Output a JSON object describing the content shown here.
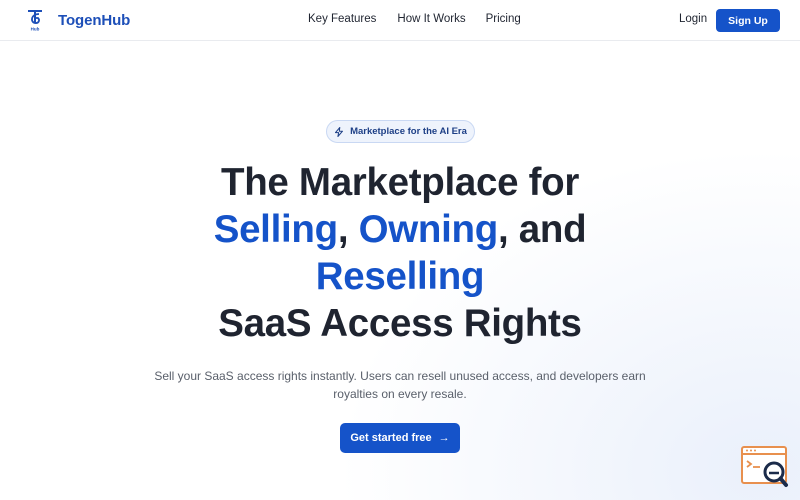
{
  "brand": {
    "name": "TogenHub",
    "logo_text": "Hub"
  },
  "nav": {
    "links": [
      "Key Features",
      "How It Works",
      "Pricing"
    ],
    "login": "Login",
    "signup": "Sign Up"
  },
  "hero": {
    "badge": "Marketplace for the AI Era",
    "headline": {
      "line1": "The Marketplace for",
      "word1": "Selling",
      "sep1": ", ",
      "word2": "Owning",
      "sep2": ", and",
      "word3": "Reselling",
      "line4": "SaaS Access Rights"
    },
    "subtitle": "Sell your SaaS access rights instantly. Users can resell unused access, and developers earn royalties on every resale.",
    "cta": "Get started free"
  },
  "colors": {
    "brand_blue": "#1553c9",
    "text_dark": "#1f2430",
    "widget_orange": "#e8904e",
    "widget_navy": "#1b2b4a"
  },
  "icons": {
    "badge": "sparkle-icon",
    "cta": "arrow-right-icon",
    "widget": "search-window-icon"
  }
}
